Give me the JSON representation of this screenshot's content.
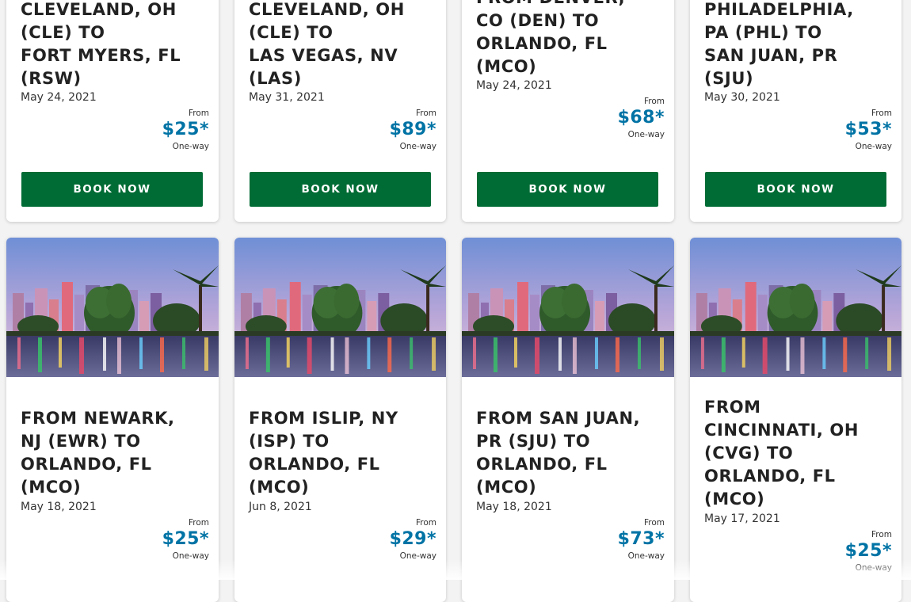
{
  "top_row": [
    {
      "route": "CLEVELAND, OH\n(CLE) TO\nFORT MYERS, FL\n(RSW)",
      "date": "May 24, 2021",
      "from": "From",
      "price": "$25*",
      "trip": "One-way",
      "button": "BOOK NOW"
    },
    {
      "route": "CLEVELAND, OH\n(CLE) TO\nLAS VEGAS, NV\n(LAS)",
      "date": "May 31, 2021",
      "from": "From",
      "price": "$89*",
      "trip": "One-way",
      "button": "BOOK NOW"
    },
    {
      "route": "FROM DENVER,\nCO (DEN) TO\nORLANDO, FL\n(MCO)",
      "date": "May 24, 2021",
      "from": "From",
      "price": "$68*",
      "trip": "One-way",
      "button": "BOOK NOW"
    },
    {
      "route": "PHILADELPHIA,\nPA (PHL) TO\nSAN JUAN, PR\n(SJU)",
      "date": "May 30, 2021",
      "from": "From",
      "price": "$53*",
      "trip": "One-way",
      "button": "BOOK NOW"
    }
  ],
  "bottom_row": [
    {
      "route": "FROM NEWARK,\nNJ (EWR) TO\nORLANDO, FL\n(MCO)",
      "date": "May 18, 2021",
      "from": "From",
      "price": "$25*",
      "trip": "One-way"
    },
    {
      "route": "FROM ISLIP, NY\n(ISP) TO\nORLANDO, FL\n(MCO)",
      "date": "Jun 8, 2021",
      "from": "From",
      "price": "$29*",
      "trip": "One-way"
    },
    {
      "route": "FROM SAN JUAN,\nPR (SJU) TO\nORLANDO, FL\n(MCO)",
      "date": "May 18, 2021",
      "from": "From",
      "price": "$73*",
      "trip": "One-way"
    },
    {
      "route": "FROM\nCINCINNATI, OH\n(CVG) TO\nORLANDO, FL\n(MCO)",
      "date": "May 17, 2021",
      "from": "From",
      "price": "$25*",
      "trip": "One-way"
    }
  ],
  "colors": {
    "button": "#006c35",
    "price": "#0073a5"
  }
}
